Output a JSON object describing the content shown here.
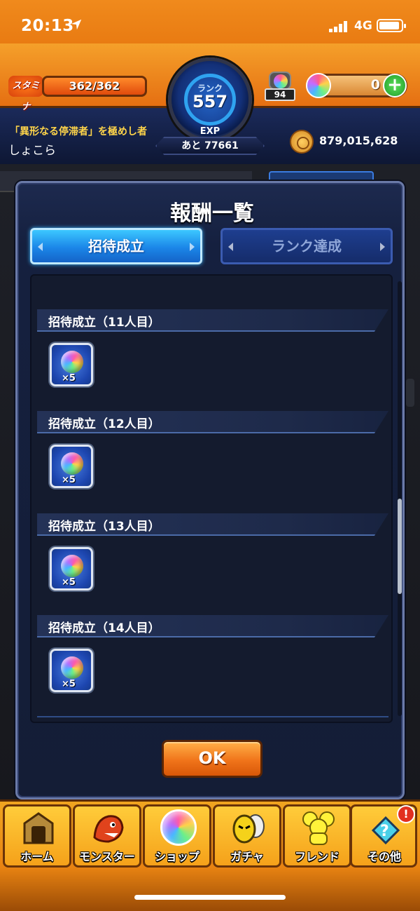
{
  "status_bar": {
    "time": "20:13",
    "network": "4G"
  },
  "header": {
    "stamina_label": "スタミナ",
    "stamina_value": "362/362",
    "stamina_fraction": 1.0,
    "rank_label": "ランク",
    "rank_value": "557",
    "exp_label": "EXP",
    "exp_remaining": "あと 77661",
    "orb_stock_count": "94",
    "orb_count": "0",
    "title_text": "「異形なる停滞者」を極めし者",
    "player_name": "しょこら",
    "gold": "879,015,628"
  },
  "modal": {
    "title": "報酬一覧",
    "tabs": [
      {
        "label": "招待成立",
        "active": true
      },
      {
        "label": "ランク達成",
        "active": false
      }
    ],
    "sections": [
      {
        "title": "招待成立（11人目）",
        "reward_qty": "×5",
        "reward_icon": "rainbow-orb-icon"
      },
      {
        "title": "招待成立（12人目）",
        "reward_qty": "×5",
        "reward_icon": "rainbow-orb-icon"
      },
      {
        "title": "招待成立（13人目）",
        "reward_qty": "×5",
        "reward_icon": "rainbow-orb-icon"
      },
      {
        "title": "招待成立（14人目）",
        "reward_qty": "×5",
        "reward_icon": "rainbow-orb-icon"
      }
    ],
    "ok_label": "OK"
  },
  "bottom_nav": [
    {
      "label": "ホーム",
      "icon": "home-gate-icon"
    },
    {
      "label": "モンスター",
      "icon": "dragon-icon"
    },
    {
      "label": "ショップ",
      "icon": "rainbow-orb-icon"
    },
    {
      "label": "ガチャ",
      "icon": "egg-icon"
    },
    {
      "label": "フレンド",
      "icon": "friends-icon"
    },
    {
      "label": "その他",
      "icon": "other-icon",
      "badge": "!"
    }
  ],
  "colors": {
    "accent_orange": "#f08a1c",
    "navy": "#15203f",
    "active_tab_blue": "#1b86e8",
    "ok_orange": "#f0741a"
  }
}
